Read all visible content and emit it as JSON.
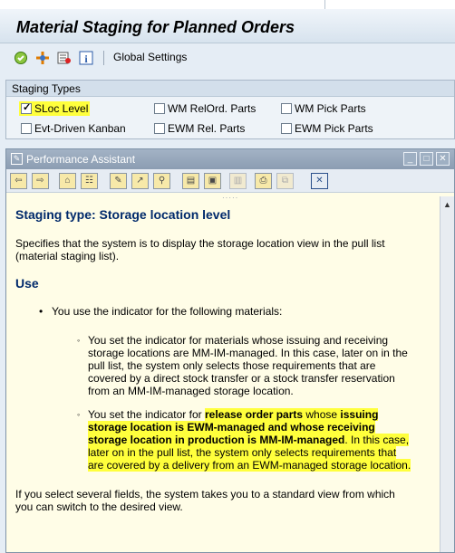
{
  "window": {
    "title": "Material Staging for Planned Orders"
  },
  "toolbar": {
    "icons": [
      "execute-icon",
      "settings-icon",
      "variant-icon",
      "info-icon"
    ],
    "global_settings_label": "Global Settings"
  },
  "staging_types": {
    "header": "Staging Types",
    "options": [
      {
        "label": "SLoc Level",
        "checked": true
      },
      {
        "label": "WM RelOrd. Parts",
        "checked": false
      },
      {
        "label": "WM Pick Parts",
        "checked": false
      },
      {
        "label": "Evt-Driven Kanban",
        "checked": false
      },
      {
        "label": "EWM Rel. Parts",
        "checked": false
      },
      {
        "label": "EWM Pick Parts",
        "checked": false
      }
    ]
  },
  "assistant": {
    "title": "Performance Assistant",
    "heading": "Staging type: Storage location level",
    "intro": [
      "Specifies that the system is to display the storage location view in the pull list",
      "(material staging list)."
    ],
    "use_heading": "Use",
    "bullet_main": "You use the indicator for the following materials:",
    "sub1": [
      "You set the indicator for materials whose issuing and receiving",
      "storage locations are MM-IM-managed. In this case, later on in the",
      "pull list, the system only selects those requirements that are",
      "covered by a direct stock transfer or a stock transfer reservation",
      "from an MM-IM-managed storage location."
    ],
    "sub2": {
      "l1a": "You set the indicator for ",
      "l1b": "release order parts",
      "l1c": " whose ",
      "l1d": "issuing",
      "l2": "storage location is EWM-managed and whose receiving",
      "l3a": "storage location in production is MM-IM-managed",
      "l3b": ". In this case,",
      "l4": "later on in the pull list, the system only selects requirements that",
      "l5": "are covered by a delivery from an EWM-managed storage location."
    },
    "footer": [
      "If you select several fields, the system takes you to a standard view from which",
      "you can switch to the desired view."
    ]
  },
  "colors": {
    "highlight": "#ffff3c",
    "heading": "#00296b",
    "panel_bg": "#fffde7"
  }
}
